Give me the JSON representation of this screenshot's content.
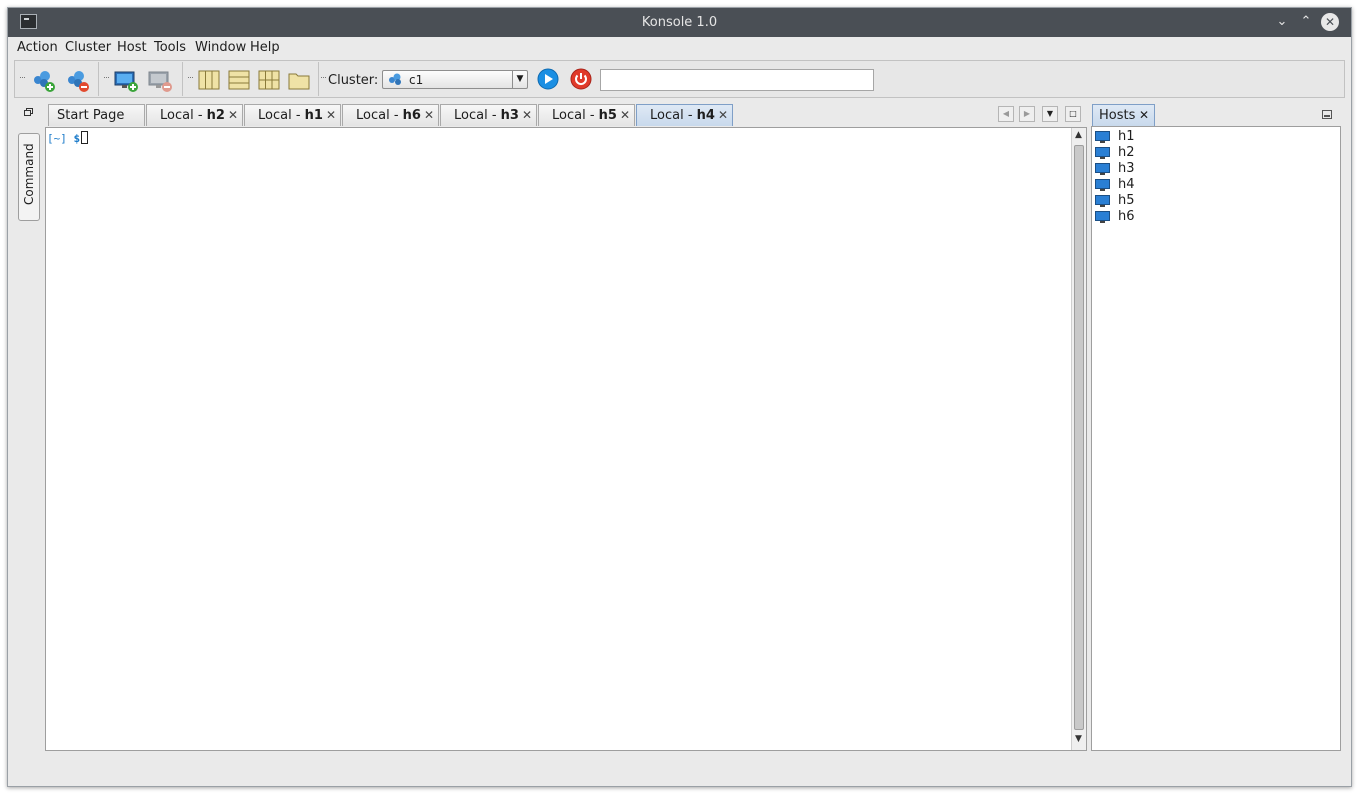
{
  "window": {
    "title": "Konsole 1.0"
  },
  "menu": [
    "Action",
    "Cluster",
    "Host",
    "Tools",
    "Window",
    "Help"
  ],
  "toolbar": {
    "cluster_label": "Cluster:",
    "cluster_value": "c1",
    "command_value": ""
  },
  "side_panel": {
    "label": "Command"
  },
  "tabs": [
    {
      "prefix": "Start Page",
      "host": ""
    },
    {
      "prefix": "Local - ",
      "host": "h2"
    },
    {
      "prefix": "Local - ",
      "host": "h1"
    },
    {
      "prefix": "Local - ",
      "host": "h6"
    },
    {
      "prefix": "Local - ",
      "host": "h3"
    },
    {
      "prefix": "Local - ",
      "host": "h5"
    },
    {
      "prefix": "Local - ",
      "host": "h4"
    }
  ],
  "active_tab": "h4",
  "terminal": {
    "prompt_dir": "[~]",
    "prompt_sym": "$"
  },
  "hosts_panel": {
    "title": "Hosts",
    "hosts": [
      "h1",
      "h2",
      "h3",
      "h4",
      "h5",
      "h6"
    ]
  },
  "colors": {
    "titlebar": "#4a4f55",
    "accent": "#1a7ac9",
    "active_tab": "#c8d9ec"
  }
}
